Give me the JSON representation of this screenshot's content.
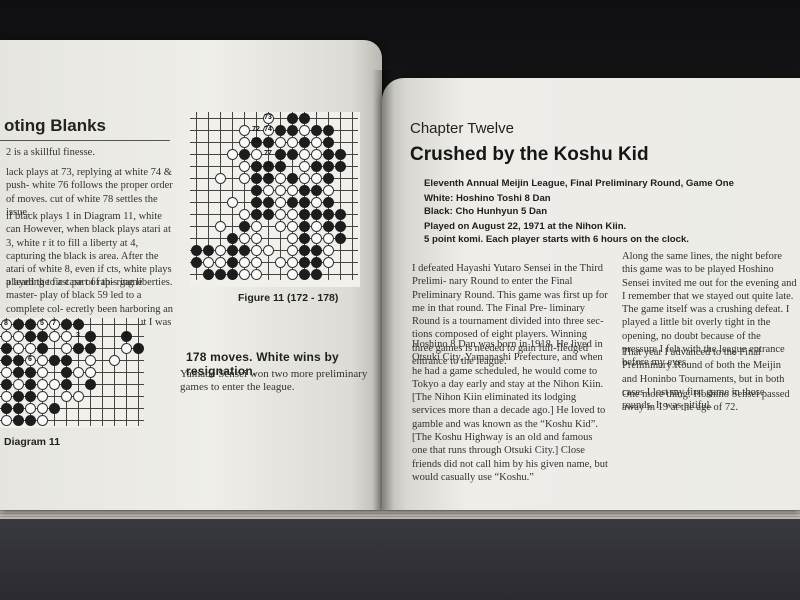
{
  "left_page": {
    "section_title": "oting Blanks",
    "paragraphs": [
      "2 is a skillful finesse.",
      "lack plays at 73, replying at white 74 & push- white 76 follows the proper order of moves. cut of white 78 settles the issue.",
      "if black plays 1 in Diagram 11, white can However, when black plays atari at 3, white r it to fill a liberty at 4, capturing the black is area. After the atari of white 8, even if cts, white plays a leading to a case of rap- ring liberties.",
      "played the first part of this game master- play of black 59 led to a complete col- ecretly been harboring an ambition of Honinbo League, but I was left with the n my mouth."
    ],
    "figure_caption": "Figure 11 (172 - 178)",
    "diagram_caption": "Diagram 11",
    "result": "178 moves. White wins by resignation.",
    "closing": "Yamabe Sensei won two more preliminary games to enter the league.",
    "figure_numbers": [
      "73",
      "72",
      "74",
      "75",
      "77",
      "76",
      "78"
    ],
    "diagram_numbers": [
      "8",
      "5",
      "7",
      "3",
      "2",
      "1",
      "6"
    ]
  },
  "right_page": {
    "chapter_label": "Chapter Twelve",
    "chapter_title": "Crushed by the Koshu Kid",
    "meta": [
      "Eleventh Annual Meijin League, Final Preliminary Round, Game One",
      "White: Hoshino Toshi 8 Dan",
      "Black: Cho Hunhyun 5 Dan",
      "Played on August 22, 1971 at the Nihon Kiin.",
      "5 point komi. Each player starts with 6 hours on the clock."
    ],
    "col1": [
      "I defeated Hayashi Yutaro Sensei in the Third Prelimi- nary Round to enter the Final Preliminary Round. This game was first up for me in that round. The Final Pre- liminary Round is a tournament divided into three sec- tions composed of eight players. Winning three games is needed to gain full-fledged entrance to the league.",
      "Hoshino 8 Dan was born in 1918. He lived in Otsuki City, Yamanashi Prefecture, and when he had a game scheduled, he would come to Tokyo a day early and stay at the Nihon Kiin. [The Nihon Kiin eliminated its lodging services more than a decade ago.] He loved to gamble and was known as the “Koshu Kid”. [The Koshu Highway is an old and famous one that runs through Otsuki City.] Close friends did not call him by his given name, but would casually use “Koshu.”"
    ],
    "col2": [
      "Along the same lines, the night before this game was to be played Hoshino Sensei invited me out for the evening and I remember that we stayed out quite late. The game itself was a crushing defeat. I played a little bit overly tight in the opening, no doubt because of the pressure I felt with the league entrance before my eyes.",
      "That year I advanced to the Final Preliminary Round of both the Meijin and Honinbo Tournaments, but in both cases I lost my first game in those rounds. It was pitiful.",
      "One more thing: Hoshino Sensei passed away in 19 at the age of 72."
    ]
  }
}
